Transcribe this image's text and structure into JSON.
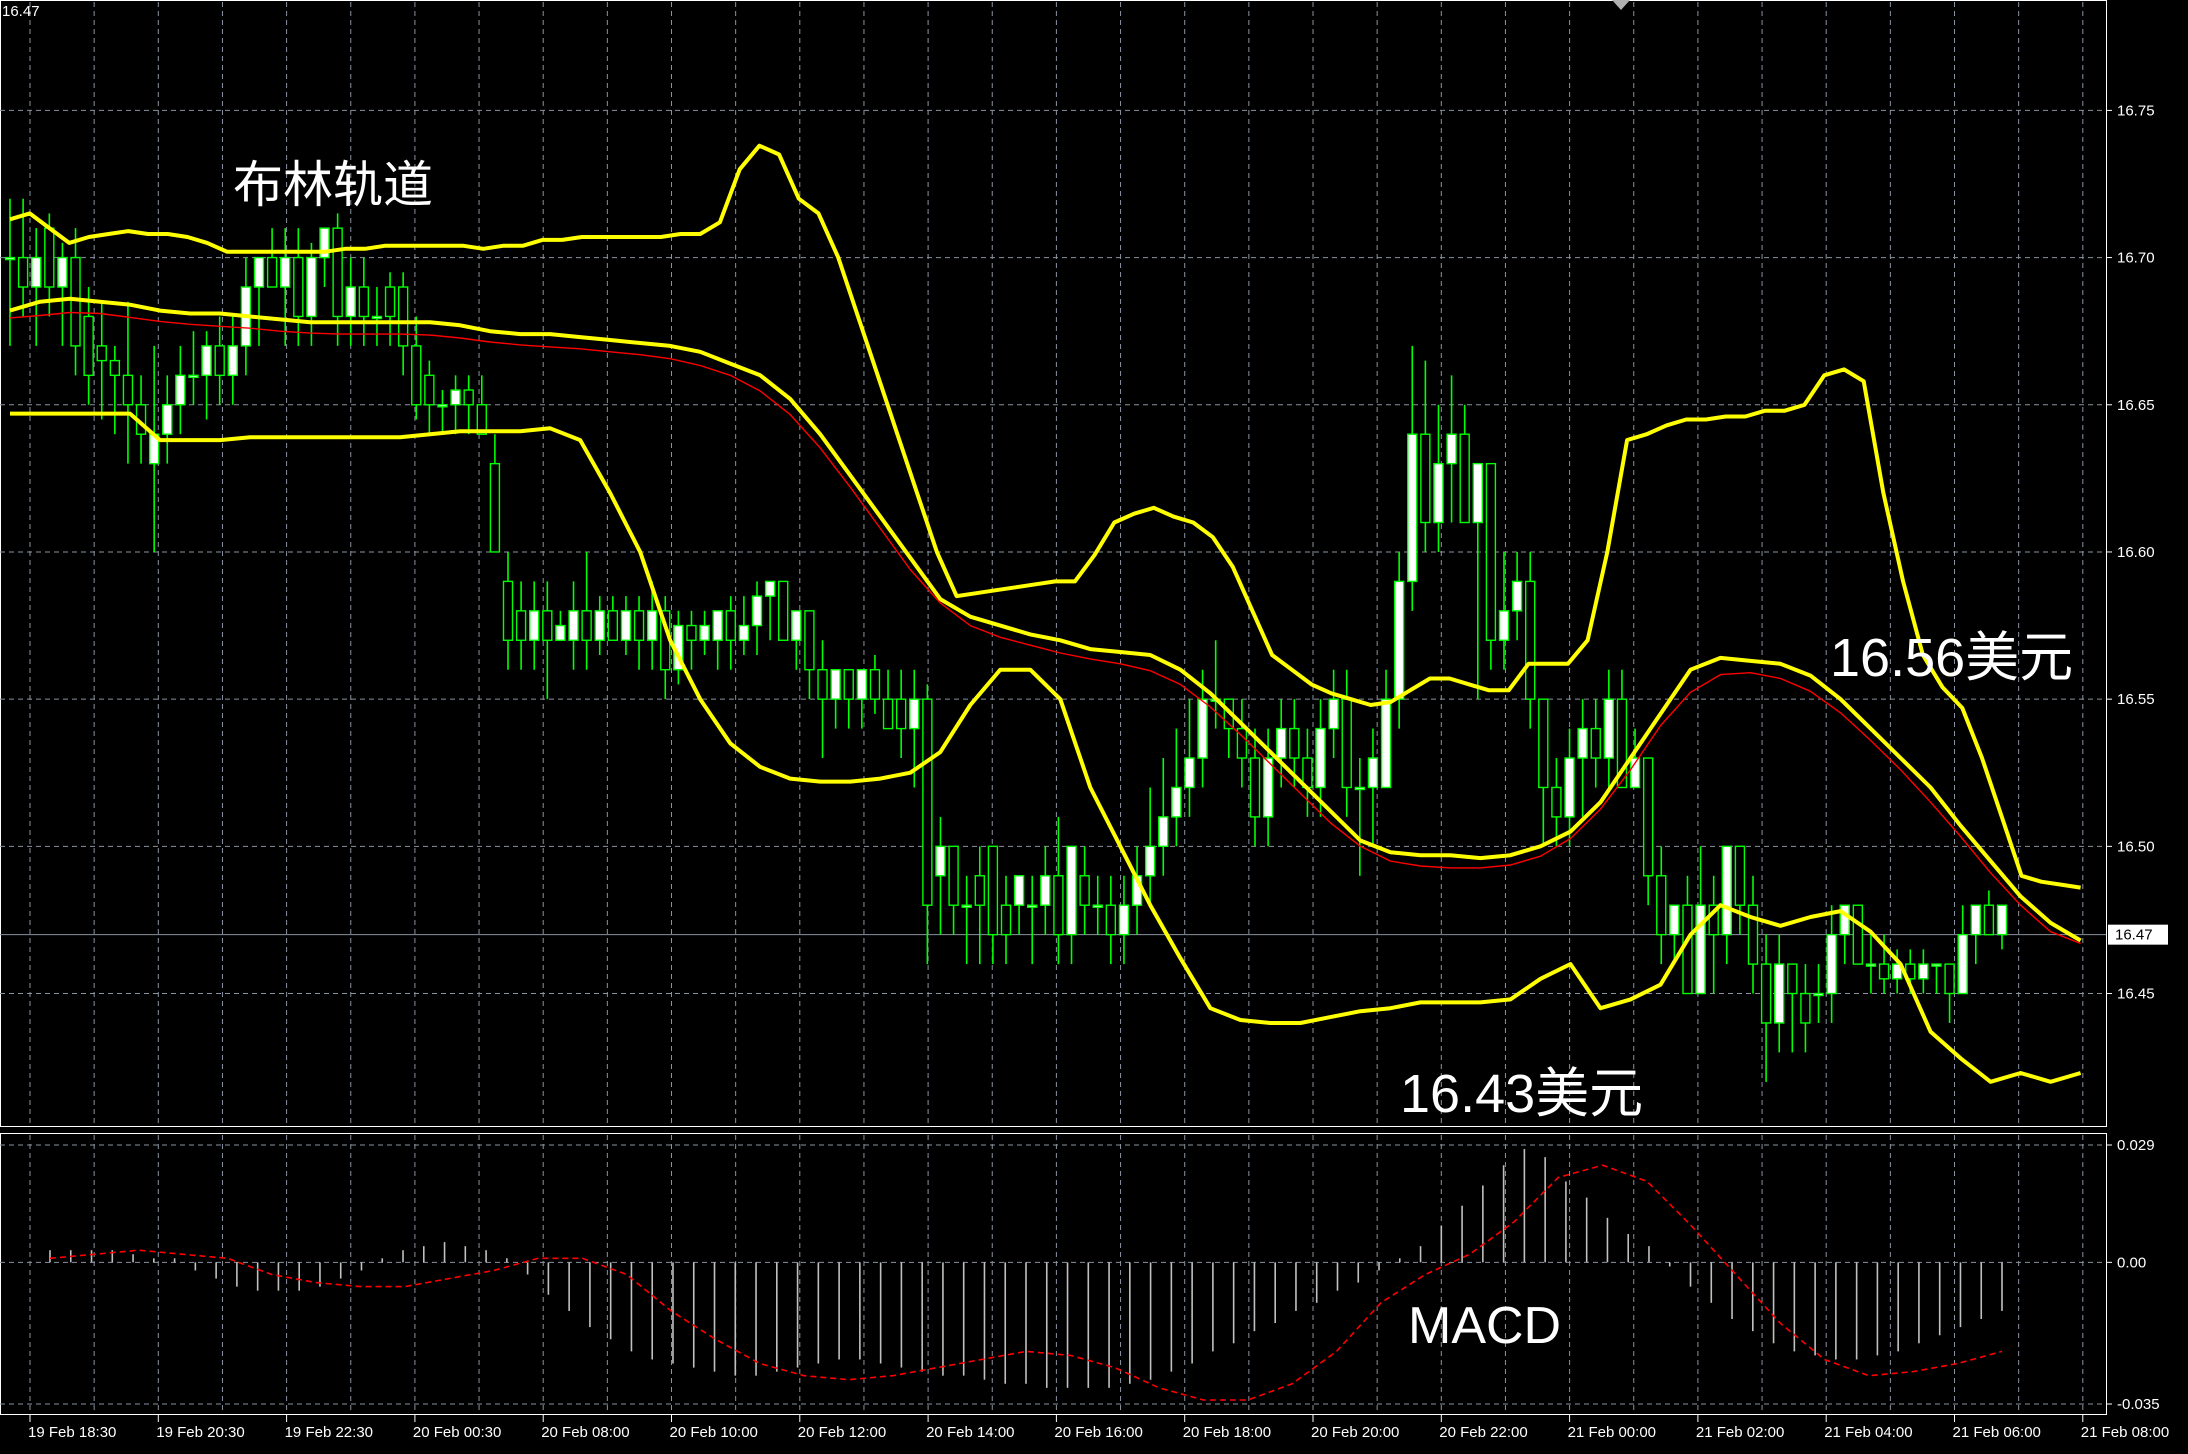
{
  "chart_data": {
    "type": "candlestick",
    "title": "",
    "ylim_main": [
      16.405,
      16.7875
    ],
    "ylim_macd": [
      -0.035,
      0.029
    ],
    "yticks_main": [
      "16.75",
      "16.70",
      "16.65",
      "16.60",
      "16.55",
      "16.50",
      "16.45"
    ],
    "yticks_macd": [
      "0.029",
      "0.00",
      "-0.035"
    ],
    "corner_label": "16.47",
    "current_price": 16.47,
    "current_price_label": "16.47",
    "xticks": [
      "19 Feb 18:30",
      "19 Feb 20:30",
      "19 Feb 22:30",
      "20 Feb 00:30",
      "20 Feb 08:00",
      "20 Feb 10:00",
      "20 Feb 12:00",
      "20 Feb 14:00",
      "20 Feb 16:00",
      "20 Feb 18:00",
      "20 Feb 20:00",
      "20 Feb 22:00",
      "21 Feb 00:00",
      "21 Feb 02:00",
      "21 Feb 04:00",
      "21 Feb 06:00",
      "21 Feb 08:00"
    ],
    "candles": [
      [
        16.7,
        16.72,
        16.67,
        16.7
      ],
      [
        16.7,
        16.72,
        16.68,
        16.69
      ],
      [
        16.69,
        16.71,
        16.67,
        16.7
      ],
      [
        16.71,
        16.715,
        16.68,
        16.69
      ],
      [
        16.69,
        16.705,
        16.67,
        16.7
      ],
      [
        16.7,
        16.71,
        16.66,
        16.67
      ],
      [
        16.68,
        16.69,
        16.65,
        16.66
      ],
      [
        16.67,
        16.685,
        16.645,
        16.665
      ],
      [
        16.665,
        16.67,
        16.64,
        16.66
      ],
      [
        16.66,
        16.685,
        16.63,
        16.65
      ],
      [
        16.65,
        16.66,
        16.63,
        16.64
      ],
      [
        16.63,
        16.67,
        16.6,
        16.64
      ],
      [
        16.64,
        16.66,
        16.63,
        16.65
      ],
      [
        16.65,
        16.67,
        16.64,
        16.66
      ],
      [
        16.66,
        16.675,
        16.65,
        16.66
      ],
      [
        16.66,
        16.675,
        16.645,
        16.67
      ],
      [
        16.67,
        16.68,
        16.65,
        16.66
      ],
      [
        16.66,
        16.68,
        16.65,
        16.67
      ],
      [
        16.67,
        16.7,
        16.66,
        16.69
      ],
      [
        16.69,
        16.7,
        16.67,
        16.7
      ],
      [
        16.7,
        16.71,
        16.69,
        16.69
      ],
      [
        16.69,
        16.71,
        16.67,
        16.7
      ],
      [
        16.7,
        16.71,
        16.67,
        16.68
      ],
      [
        16.68,
        16.705,
        16.67,
        16.7
      ],
      [
        16.7,
        16.71,
        16.69,
        16.71
      ],
      [
        16.71,
        16.715,
        16.67,
        16.68
      ],
      [
        16.68,
        16.7,
        16.67,
        16.69
      ],
      [
        16.69,
        16.7,
        16.67,
        16.68
      ],
      [
        16.68,
        16.69,
        16.67,
        16.68
      ],
      [
        16.69,
        16.695,
        16.67,
        16.68
      ],
      [
        16.69,
        16.695,
        16.66,
        16.67
      ],
      [
        16.67,
        16.68,
        16.645,
        16.65
      ],
      [
        16.66,
        16.665,
        16.64,
        16.65
      ],
      [
        16.65,
        16.655,
        16.64,
        16.65
      ],
      [
        16.65,
        16.66,
        16.64,
        16.655
      ],
      [
        16.655,
        16.66,
        16.64,
        16.65
      ],
      [
        16.65,
        16.66,
        16.64,
        16.64
      ],
      [
        16.63,
        16.64,
        16.6,
        16.6
      ],
      [
        16.59,
        16.6,
        16.56,
        16.57
      ],
      [
        16.58,
        16.59,
        16.56,
        16.57
      ],
      [
        16.57,
        16.59,
        16.56,
        16.58
      ],
      [
        16.58,
        16.59,
        16.55,
        16.57
      ],
      [
        16.57,
        16.58,
        16.57,
        16.575
      ],
      [
        16.57,
        16.59,
        16.56,
        16.58
      ],
      [
        16.58,
        16.6,
        16.56,
        16.57
      ],
      [
        16.57,
        16.585,
        16.565,
        16.58
      ],
      [
        16.58,
        16.585,
        16.57,
        16.57
      ],
      [
        16.57,
        16.585,
        16.565,
        16.58
      ],
      [
        16.58,
        16.585,
        16.56,
        16.57
      ],
      [
        16.57,
        16.59,
        16.56,
        16.58
      ],
      [
        16.58,
        16.585,
        16.55,
        16.56
      ],
      [
        16.56,
        16.58,
        16.555,
        16.575
      ],
      [
        16.575,
        16.58,
        16.56,
        16.57
      ],
      [
        16.57,
        16.58,
        16.565,
        16.575
      ],
      [
        16.57,
        16.58,
        16.56,
        16.58
      ],
      [
        16.58,
        16.585,
        16.56,
        16.57
      ],
      [
        16.57,
        16.585,
        16.565,
        16.575
      ],
      [
        16.575,
        16.59,
        16.565,
        16.585
      ],
      [
        16.585,
        16.59,
        16.57,
        16.59
      ],
      [
        16.59,
        16.59,
        16.57,
        16.57
      ],
      [
        16.57,
        16.58,
        16.56,
        16.58
      ],
      [
        16.58,
        16.58,
        16.55,
        16.56
      ],
      [
        16.56,
        16.57,
        16.53,
        16.55
      ],
      [
        16.55,
        16.56,
        16.54,
        16.56
      ],
      [
        16.56,
        16.56,
        16.54,
        16.55
      ],
      [
        16.55,
        16.56,
        16.54,
        16.56
      ],
      [
        16.56,
        16.565,
        16.545,
        16.55
      ],
      [
        16.55,
        16.56,
        16.54,
        16.54
      ],
      [
        16.55,
        16.56,
        16.53,
        16.54
      ],
      [
        16.54,
        16.56,
        16.52,
        16.55
      ],
      [
        16.55,
        16.555,
        16.46,
        16.48
      ],
      [
        16.49,
        16.51,
        16.47,
        16.5
      ],
      [
        16.5,
        16.5,
        16.47,
        16.48
      ],
      [
        16.48,
        16.49,
        16.46,
        16.48
      ],
      [
        16.49,
        16.5,
        16.46,
        16.48
      ],
      [
        16.5,
        16.5,
        16.46,
        16.47
      ],
      [
        16.48,
        16.49,
        16.46,
        16.47
      ],
      [
        16.48,
        16.49,
        16.47,
        16.49
      ],
      [
        16.48,
        16.49,
        16.46,
        16.48
      ],
      [
        16.48,
        16.5,
        16.47,
        16.49
      ],
      [
        16.49,
        16.51,
        16.46,
        16.47
      ],
      [
        16.47,
        16.5,
        16.46,
        16.5
      ],
      [
        16.49,
        16.5,
        16.47,
        16.48
      ],
      [
        16.48,
        16.49,
        16.47,
        16.48
      ],
      [
        16.48,
        16.49,
        16.46,
        16.47
      ],
      [
        16.47,
        16.49,
        16.46,
        16.48
      ],
      [
        16.48,
        16.5,
        16.47,
        16.49
      ],
      [
        16.49,
        16.52,
        16.48,
        16.5
      ],
      [
        16.5,
        16.53,
        16.49,
        16.51
      ],
      [
        16.51,
        16.54,
        16.5,
        16.52
      ],
      [
        16.52,
        16.55,
        16.51,
        16.53
      ],
      [
        16.53,
        16.56,
        16.52,
        16.55
      ],
      [
        16.55,
        16.57,
        16.54,
        16.55
      ],
      [
        16.55,
        16.55,
        16.53,
        16.54
      ],
      [
        16.54,
        16.55,
        16.52,
        16.53
      ],
      [
        16.53,
        16.54,
        16.5,
        16.51
      ],
      [
        16.51,
        16.54,
        16.5,
        16.53
      ],
      [
        16.53,
        16.55,
        16.52,
        16.54
      ],
      [
        16.54,
        16.55,
        16.52,
        16.53
      ],
      [
        16.53,
        16.54,
        16.51,
        16.52
      ],
      [
        16.52,
        16.55,
        16.51,
        16.54
      ],
      [
        16.54,
        16.56,
        16.53,
        16.55
      ],
      [
        16.55,
        16.56,
        16.51,
        16.52
      ],
      [
        16.52,
        16.53,
        16.49,
        16.52
      ],
      [
        16.52,
        16.54,
        16.5,
        16.53
      ],
      [
        16.52,
        16.56,
        16.52,
        16.55
      ],
      [
        16.55,
        16.6,
        16.54,
        16.59
      ],
      [
        16.59,
        16.67,
        16.58,
        16.64
      ],
      [
        16.64,
        16.665,
        16.6,
        16.61
      ],
      [
        16.61,
        16.65,
        16.6,
        16.63
      ],
      [
        16.63,
        16.66,
        16.61,
        16.64
      ],
      [
        16.64,
        16.65,
        16.61,
        16.61
      ],
      [
        16.61,
        16.63,
        16.55,
        16.63
      ],
      [
        16.63,
        16.63,
        16.56,
        16.57
      ],
      [
        16.57,
        16.6,
        16.56,
        16.58
      ],
      [
        16.58,
        16.6,
        16.57,
        16.59
      ],
      [
        16.59,
        16.6,
        16.54,
        16.55
      ],
      [
        16.55,
        16.55,
        16.5,
        16.52
      ],
      [
        16.52,
        16.53,
        16.5,
        16.51
      ],
      [
        16.51,
        16.54,
        16.5,
        16.53
      ],
      [
        16.53,
        16.55,
        16.51,
        16.54
      ],
      [
        16.54,
        16.55,
        16.52,
        16.53
      ],
      [
        16.53,
        16.56,
        16.52,
        16.55
      ],
      [
        16.55,
        16.56,
        16.52,
        16.52
      ],
      [
        16.52,
        16.54,
        16.52,
        16.53
      ],
      [
        16.53,
        16.53,
        16.48,
        16.49
      ],
      [
        16.49,
        16.5,
        16.46,
        16.47
      ],
      [
        16.47,
        16.48,
        16.46,
        16.48
      ],
      [
        16.48,
        16.49,
        16.45,
        16.45
      ],
      [
        16.45,
        16.5,
        16.45,
        16.48
      ],
      [
        16.48,
        16.49,
        16.45,
        16.47
      ],
      [
        16.47,
        16.5,
        16.46,
        16.5
      ],
      [
        16.5,
        16.5,
        16.47,
        16.48
      ],
      [
        16.48,
        16.49,
        16.45,
        16.46
      ],
      [
        16.46,
        16.47,
        16.42,
        16.44
      ],
      [
        16.44,
        16.47,
        16.43,
        16.46
      ],
      [
        16.46,
        16.46,
        16.43,
        16.45
      ],
      [
        16.45,
        16.46,
        16.43,
        16.44
      ],
      [
        16.45,
        16.46,
        16.44,
        16.45
      ],
      [
        16.45,
        16.48,
        16.44,
        16.47
      ],
      [
        16.47,
        16.48,
        16.46,
        16.48
      ],
      [
        16.48,
        16.48,
        16.46,
        16.46
      ],
      [
        16.46,
        16.47,
        16.45,
        16.46
      ],
      [
        16.46,
        16.47,
        16.45,
        16.455
      ],
      [
        16.455,
        16.465,
        16.45,
        16.46
      ],
      [
        16.46,
        16.465,
        16.45,
        16.455
      ],
      [
        16.455,
        16.465,
        16.45,
        16.46
      ],
      [
        16.46,
        16.46,
        16.45,
        16.46
      ],
      [
        16.46,
        16.46,
        16.44,
        16.45
      ],
      [
        16.45,
        16.48,
        16.45,
        16.47
      ],
      [
        16.47,
        16.48,
        16.46,
        16.48
      ],
      [
        16.48,
        16.485,
        16.47,
        16.47
      ],
      [
        16.47,
        16.48,
        16.465,
        16.48
      ]
    ],
    "bollinger": {
      "upper": [
        16.713,
        16.715,
        16.71,
        16.705,
        16.707,
        16.708,
        16.709,
        16.708,
        16.708,
        16.707,
        16.705,
        16.702,
        16.702,
        16.702,
        16.702,
        16.702,
        16.702,
        16.703,
        16.703,
        16.704,
        16.704,
        16.704,
        16.704,
        16.704,
        16.703,
        16.704,
        16.704,
        16.706,
        16.706,
        16.707,
        16.707,
        16.707,
        16.707,
        16.707,
        16.708,
        16.708,
        16.712,
        16.73,
        16.738,
        16.735,
        16.72,
        16.715,
        16.7,
        16.68,
        16.66,
        16.64,
        16.62,
        16.6,
        16.585,
        16.586,
        16.587,
        16.588,
        16.589,
        16.59,
        16.59,
        16.599,
        16.61,
        16.613,
        16.615,
        16.612,
        16.61,
        16.605,
        16.595,
        16.58,
        16.565,
        16.56,
        16.555,
        16.552,
        16.55,
        16.548,
        16.549,
        16.553,
        16.557,
        16.557,
        16.555,
        16.553,
        16.553,
        16.562,
        16.562,
        16.562,
        16.57,
        16.6,
        16.638,
        16.64,
        16.643,
        16.645,
        16.645,
        16.646,
        16.646,
        16.648,
        16.648,
        16.65,
        16.66,
        16.662,
        16.658,
        16.62,
        16.59,
        16.565,
        16.554,
        16.547,
        16.53,
        16.51,
        16.49,
        16.488,
        16.487,
        16.486
      ],
      "middle": [
        16.682,
        16.685,
        16.686,
        16.685,
        16.684,
        16.682,
        16.681,
        16.681,
        16.68,
        16.679,
        16.678,
        16.678,
        16.678,
        16.678,
        16.678,
        16.677,
        16.675,
        16.674,
        16.674,
        16.673,
        16.672,
        16.671,
        16.67,
        16.668,
        16.664,
        16.66,
        16.652,
        16.64,
        16.626,
        16.612,
        16.598,
        16.584,
        16.578,
        16.575,
        16.572,
        16.57,
        16.567,
        16.566,
        16.565,
        16.56,
        16.552,
        16.542,
        16.532,
        16.522,
        16.512,
        16.502,
        16.498,
        16.497,
        16.497,
        16.496,
        16.497,
        16.5,
        16.505,
        16.515,
        16.53,
        16.545,
        16.56,
        16.564,
        16.563,
        16.562,
        16.558,
        16.55,
        16.54,
        16.53,
        16.52,
        16.507,
        16.495,
        16.483,
        16.474,
        16.468
      ],
      "lower": [
        16.647,
        16.647,
        16.647,
        16.647,
        16.647,
        16.638,
        16.638,
        16.638,
        16.639,
        16.639,
        16.639,
        16.639,
        16.639,
        16.639,
        16.64,
        16.641,
        16.641,
        16.641,
        16.642,
        16.638,
        16.62,
        16.6,
        16.57,
        16.55,
        16.535,
        16.527,
        16.523,
        16.522,
        16.522,
        16.523,
        16.525,
        16.532,
        16.548,
        16.56,
        16.56,
        16.55,
        16.52,
        16.5,
        16.48,
        16.462,
        16.445,
        16.441,
        16.44,
        16.44,
        16.442,
        16.444,
        16.445,
        16.447,
        16.447,
        16.447,
        16.448,
        16.455,
        16.46,
        16.445,
        16.448,
        16.453,
        16.47,
        16.48,
        16.476,
        16.473,
        16.476,
        16.478,
        16.471,
        16.46,
        16.437,
        16.428,
        16.42,
        16.423,
        16.42,
        16.423
      ]
    },
    "bollinger_x_span": [
      0,
      158
    ],
    "macd_signal": [
      0.001,
      0.002,
      0.003,
      0.002,
      0.001,
      -0.003,
      -0.005,
      -0.006,
      -0.006,
      -0.004,
      -0.002,
      0.001,
      0.001,
      -0.003,
      -0.012,
      -0.019,
      -0.025,
      -0.028,
      -0.029,
      -0.028,
      -0.026,
      -0.024,
      -0.022,
      -0.023,
      -0.026,
      -0.031,
      -0.034,
      -0.034,
      -0.03,
      -0.022,
      -0.01,
      -0.003,
      0.002,
      0.01,
      0.021,
      0.024,
      0.02,
      0.009,
      -0.003,
      -0.015,
      -0.024,
      -0.028,
      -0.027,
      -0.025,
      -0.022
    ],
    "macd_hist": [
      0.003,
      0.003,
      0.003,
      0.003,
      0.002,
      0.001,
      0.001,
      -0.002,
      -0.004,
      -0.006,
      -0.007,
      -0.007,
      -0.007,
      -0.006,
      -0.004,
      -0.002,
      0.001,
      0.003,
      0.004,
      0.005,
      0.004,
      0.003,
      0.001,
      -0.003,
      -0.008,
      -0.012,
      -0.016,
      -0.019,
      -0.022,
      -0.024,
      -0.025,
      -0.026,
      -0.027,
      -0.028,
      -0.028,
      -0.027,
      -0.026,
      -0.025,
      -0.024,
      -0.024,
      -0.025,
      -0.026,
      -0.027,
      -0.028,
      -0.028,
      -0.029,
      -0.03,
      -0.03,
      -0.031,
      -0.031,
      -0.031,
      -0.031,
      -0.03,
      -0.029,
      -0.027,
      -0.025,
      -0.022,
      -0.02,
      -0.017,
      -0.015,
      -0.012,
      -0.01,
      -0.007,
      -0.005,
      -0.002,
      0.001,
      0.004,
      0.009,
      0.014,
      0.019,
      0.024,
      0.028,
      0.026,
      0.02,
      0.016,
      0.011,
      0.007,
      0.004,
      -0.001,
      -0.006,
      -0.01,
      -0.014,
      -0.017,
      -0.02,
      -0.022,
      -0.023,
      -0.024,
      -0.024,
      -0.023,
      -0.022,
      -0.02,
      -0.018,
      -0.016,
      -0.014,
      -0.012
    ]
  },
  "annotations": {
    "bollinger_label": "布林轨道",
    "upper_price_label": "16.56美元",
    "lower_price_label": "16.43美元",
    "macd_label": "MACD"
  },
  "colors": {
    "background": "#000000",
    "grid": "#8a93a0",
    "bull_candle": "#00ff00",
    "bull_body": "#ffffff",
    "bollinger": "#ffff00",
    "moving_average": "#ff0000",
    "macd_hist": "#c0c0c0",
    "macd_signal": "#ff0000",
    "current_price_line": "#8a93a0",
    "text": "#ffffff"
  }
}
